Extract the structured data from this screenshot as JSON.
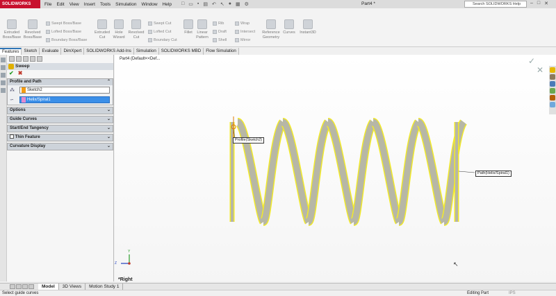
{
  "app": {
    "brand": "SOLIDWORKS",
    "doc_title": "Part4 *"
  },
  "menu": [
    "File",
    "Edit",
    "View",
    "Insert",
    "Tools",
    "Simulation",
    "Window",
    "Help"
  ],
  "search": {
    "placeholder": "Search SOLIDWORKS Help"
  },
  "ribbon": {
    "extruded_boss": "Extruded Boss/Base",
    "revolved_boss": "Revolved Boss/Base",
    "swept_boss": "Swept Boss/Base",
    "lofted_boss": "Lofted Boss/Base",
    "boundary_boss": "Boundary Boss/Base",
    "extruded_cut": "Extruded Cut",
    "hole_wizard": "Hole Wizard",
    "revolved_cut": "Revolved Cut",
    "swept_cut": "Swept Cut",
    "lofted_cut": "Lofted Cut",
    "boundary_cut": "Boundary Cut",
    "fillet": "Fillet",
    "linear_pattern": "Linear Pattern",
    "rib": "Rib",
    "draft": "Draft",
    "shell": "Shell",
    "wrap": "Wrap",
    "intersect": "Intersect",
    "mirror": "Mirror",
    "reference_geometry": "Reference Geometry",
    "curves": "Curves",
    "instant3d": "Instant3D"
  },
  "tabs": [
    "Features",
    "Sketch",
    "Evaluate",
    "DimXpert",
    "SOLIDWORKS Add-Ins",
    "Simulation",
    "SOLIDWORKS MBD",
    "Flow Simulation"
  ],
  "property_manager": {
    "title": "Sweep",
    "groups": {
      "profile_path": "Profile and Path",
      "options": "Options",
      "guide_curves": "Guide Curves",
      "start_end_tangency": "Start/End Tangency",
      "thin_feature": "Thin Feature",
      "curvature_display": "Curvature Display"
    },
    "profile_value": "Sketch2",
    "path_value": "Helix/Spiral1"
  },
  "viewport": {
    "tree_root": "Part4  (Default<<Def...",
    "profile_callout": "Profile(Sketch2)",
    "path_callout": "Path(Helix/Spiral1)",
    "view_name": "*Right",
    "triad": {
      "x": "Z",
      "y": "Y"
    }
  },
  "bottom_tabs": [
    "Model",
    "3D Views",
    "Motion Study 1"
  ],
  "status": {
    "hint": "Select guide curves",
    "mode": "Editing Part",
    "units": "IPS"
  },
  "colors": {
    "accent": "#2e74b5",
    "helix": "#f2ea2a",
    "helix_shade": "#b7b7a6",
    "brand": "#c8102e",
    "selected": "#3b8fe8"
  }
}
